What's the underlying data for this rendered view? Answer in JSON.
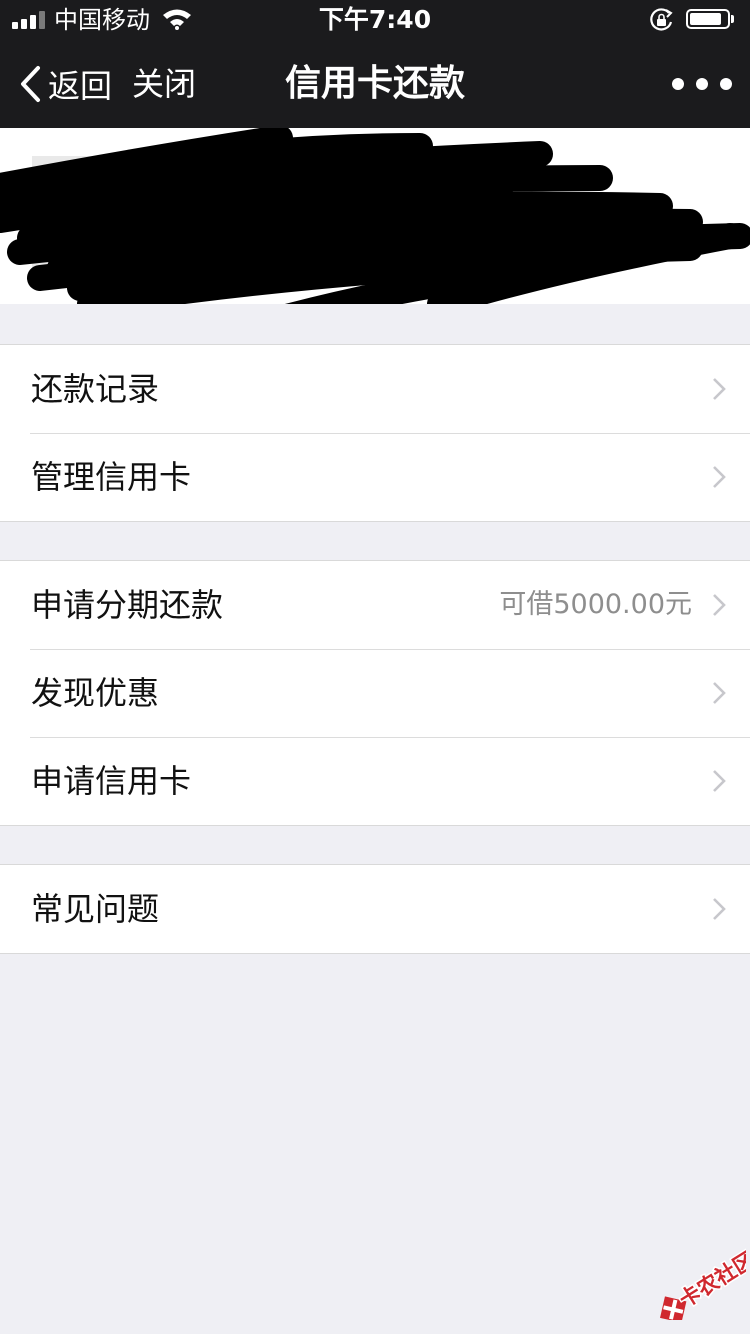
{
  "status_bar": {
    "carrier": "中国移动",
    "time": "下午7:40",
    "battery_level": 0.85
  },
  "nav": {
    "back_label": "返回",
    "close_label": "关闭",
    "title": "信用卡还款"
  },
  "groups": [
    {
      "rows": [
        {
          "label": "还款记录"
        },
        {
          "label": "管理信用卡"
        }
      ]
    },
    {
      "rows": [
        {
          "label": "申请分期还款",
          "detail": "可借5000.00元"
        },
        {
          "label": "发现优惠"
        },
        {
          "label": "申请信用卡"
        }
      ]
    },
    {
      "rows": [
        {
          "label": "常见问题"
        }
      ]
    }
  ],
  "watermark": {
    "text": "卡农社区"
  },
  "colors": {
    "nav_background": "#1b1b1d",
    "page_background": "#efeff4",
    "detail_text": "#8e8e8e",
    "watermark_red": "#d0282e"
  }
}
